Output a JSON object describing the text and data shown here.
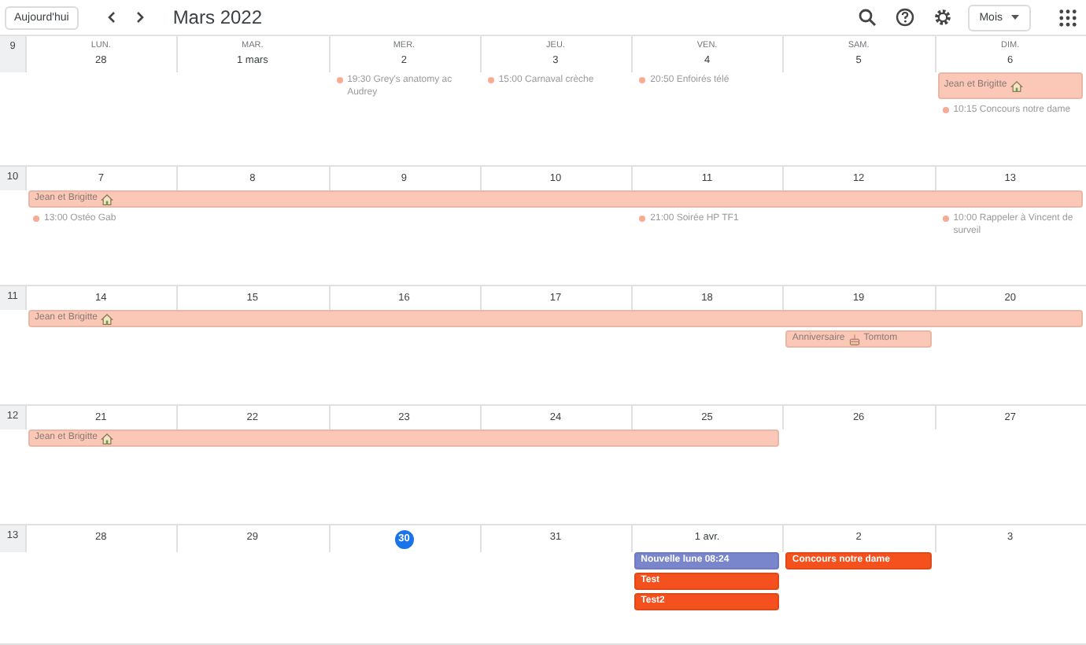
{
  "toolbar": {
    "today_button": "Aujourd'hui",
    "title": "Mars 2022",
    "view_menu": "Mois"
  },
  "weekdays": [
    "LUN.",
    "MAR.",
    "MER.",
    "JEU.",
    "VEN.",
    "SAM.",
    "DIM."
  ],
  "weeks": [
    {
      "number": "9",
      "days": [
        {
          "label": "28",
          "today": false
        },
        {
          "label": "1 mars",
          "today": false
        },
        {
          "label": "2",
          "today": false,
          "events": [
            {
              "kind": "timed",
              "faded": true,
              "color": "#f6ab94",
              "time": "19:30",
              "title": "Grey's anatomy ac Audrey"
            }
          ]
        },
        {
          "label": "3",
          "today": false,
          "events": [
            {
              "kind": "timed",
              "faded": true,
              "color": "#f6ab94",
              "time": "15:00",
              "title": "Carnaval crèche"
            }
          ]
        },
        {
          "label": "4",
          "today": false,
          "events": [
            {
              "kind": "timed",
              "faded": true,
              "color": "#f6ab94",
              "time": "20:50",
              "title": "Enfoirés télé"
            }
          ]
        },
        {
          "label": "5",
          "today": false
        },
        {
          "label": "6",
          "today": false,
          "events": [
            {
              "kind": "bar",
              "faded": true,
              "color": "#fbc7b6",
              "segments": [
                {
                  "kind": "text",
                  "text": "Jean et Brigitte"
                },
                {
                  "kind": "house"
                }
              ]
            },
            {
              "kind": "timed",
              "faded": true,
              "color": "#f6ab94",
              "time": "10:15",
              "title": "Concours notre dame"
            }
          ]
        }
      ]
    },
    {
      "number": "10",
      "days": [
        {
          "label": "7",
          "today": false,
          "events": [
            {
              "kind": "bar",
              "faded": true,
              "color": "#fbc7b6",
              "segments": [
                {
                  "kind": "text",
                  "text": "Jean et Brigitte"
                },
                {
                  "kind": "house"
                }
              ]
            },
            {
              "kind": "timed",
              "faded": true,
              "color": "#f6ab94",
              "time": "13:00",
              "title": "Ostéo Gab"
            }
          ]
        },
        {
          "label": "8",
          "today": false,
          "events": [
            {
              "kind": "continued"
            }
          ]
        },
        {
          "label": "9",
          "today": false,
          "events": [
            {
              "kind": "continued"
            }
          ]
        },
        {
          "label": "10",
          "today": false,
          "events": [
            {
              "kind": "continued"
            }
          ]
        },
        {
          "label": "11",
          "today": false,
          "events": [
            {
              "kind": "continued"
            },
            {
              "kind": "timed",
              "faded": true,
              "color": "#f6ab94",
              "time": "21:00",
              "title": "Soirée HP TF1"
            }
          ]
        },
        {
          "label": "12",
          "today": false,
          "events": [
            {
              "kind": "continued"
            }
          ]
        },
        {
          "label": "13",
          "today": false,
          "events": [
            {
              "kind": "continued"
            },
            {
              "kind": "timed",
              "faded": true,
              "color": "#f6ab94",
              "time": "10:00",
              "title": "Rappeler à Vincent de surveil"
            }
          ]
        }
      ]
    },
    {
      "number": "11",
      "days": [
        {
          "label": "14",
          "today": false,
          "events": [
            {
              "kind": "bar",
              "faded": true,
              "color": "#fbc7b6",
              "segments": [
                {
                  "kind": "text",
                  "text": "Jean et Brigitte"
                },
                {
                  "kind": "house"
                }
              ]
            }
          ]
        },
        {
          "label": "15",
          "today": false,
          "events": [
            {
              "kind": "continued"
            }
          ]
        },
        {
          "label": "16",
          "today": false,
          "events": [
            {
              "kind": "continued"
            }
          ]
        },
        {
          "label": "17",
          "today": false,
          "events": [
            {
              "kind": "continued"
            }
          ]
        },
        {
          "label": "18",
          "today": false,
          "events": [
            {
              "kind": "continued"
            }
          ]
        },
        {
          "label": "19",
          "today": false,
          "events": [
            {
              "kind": "continued"
            },
            {
              "kind": "bar",
              "faded": true,
              "color": "#fbc7b6",
              "segments": [
                {
                  "kind": "text",
                  "text": "Anniversaire"
                },
                {
                  "kind": "cake"
                },
                {
                  "kind": "text",
                  "text": "Tomtom"
                }
              ]
            }
          ]
        },
        {
          "label": "20",
          "today": false,
          "events": [
            {
              "kind": "continued"
            }
          ]
        }
      ]
    },
    {
      "number": "12",
      "days": [
        {
          "label": "21",
          "today": false,
          "events": [
            {
              "kind": "bar",
              "faded": true,
              "color": "#fbc7b6",
              "segments": [
                {
                  "kind": "text",
                  "text": "Jean et Brigitte"
                },
                {
                  "kind": "house"
                }
              ]
            }
          ]
        },
        {
          "label": "22",
          "today": false,
          "events": [
            {
              "kind": "continued"
            }
          ]
        },
        {
          "label": "23",
          "today": false,
          "events": [
            {
              "kind": "continued"
            }
          ]
        },
        {
          "label": "24",
          "today": false,
          "events": [
            {
              "kind": "continued"
            }
          ]
        },
        {
          "label": "25",
          "today": false,
          "events": [
            {
              "kind": "continued"
            }
          ]
        },
        {
          "label": "26",
          "today": false
        },
        {
          "label": "27",
          "today": false
        }
      ]
    },
    {
      "number": "13",
      "days": [
        {
          "label": "28",
          "today": false
        },
        {
          "label": "29",
          "today": false
        },
        {
          "label": "30",
          "today": true
        },
        {
          "label": "31",
          "today": false
        },
        {
          "label": "1 avr.",
          "today": false,
          "events": [
            {
              "kind": "bar",
              "faded": false,
              "color": "#7986cb",
              "segments": [
                {
                  "kind": "text",
                  "text": "Nouvelle lune 08:24"
                }
              ]
            },
            {
              "kind": "bar",
              "faded": false,
              "color": "#f4511e",
              "segments": [
                {
                  "kind": "text",
                  "text": "Test"
                }
              ]
            },
            {
              "kind": "bar",
              "faded": false,
              "color": "#f4511e",
              "segments": [
                {
                  "kind": "text",
                  "text": "Test2"
                }
              ]
            }
          ]
        },
        {
          "label": "2",
          "today": false,
          "events": [
            {
              "kind": "bar",
              "faded": false,
              "color": "#f4511e",
              "segments": [
                {
                  "kind": "text",
                  "text": "Concours notre dame"
                }
              ]
            }
          ]
        },
        {
          "label": "3",
          "today": false
        }
      ]
    }
  ]
}
